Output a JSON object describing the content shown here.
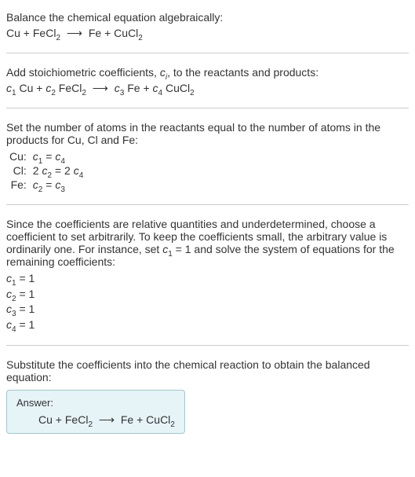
{
  "section1": {
    "heading": "Balance the chemical equation algebraically:"
  },
  "chem": {
    "Cu": "Cu",
    "plus": " + ",
    "FeCl": "FeCl",
    "two": "2",
    "arrow": "⟶",
    "Fe": "Fe",
    "CuCl": "CuCl"
  },
  "section2": {
    "heading_a": "Add stoichiometric coefficients, ",
    "heading_b": ", to the reactants and products:",
    "c": "c",
    "i": "i",
    "one": "1",
    "two": "2",
    "three": "3",
    "four": "4",
    "sp": " "
  },
  "section3": {
    "heading": "Set the number of atoms in the reactants equal to the number of atoms in the products for Cu, Cl and Fe:",
    "rows": [
      {
        "el": "Cu:",
        "lhs_a": "c",
        "lhs_b": "1",
        "eq": " = ",
        "rhs_a": "c",
        "rhs_b": "4"
      },
      {
        "el": "Cl:",
        "lhs_pre": "2 ",
        "lhs_a": "c",
        "lhs_b": "2",
        "eq": " = 2 ",
        "rhs_a": "c",
        "rhs_b": "4"
      },
      {
        "el": "Fe:",
        "lhs_a": "c",
        "lhs_b": "2",
        "eq": " = ",
        "rhs_a": "c",
        "rhs_b": "3"
      }
    ]
  },
  "section4": {
    "heading_a": "Since the coefficients are relative quantities and underdetermined, choose a coefficient to set arbitrarily. To keep the coefficients small, the arbitrary value is ordinarily one. For instance, set ",
    "heading_b": " = 1 and solve the system of equations for the remaining coefficients:",
    "c": "c",
    "one": "1",
    "coefs": [
      {
        "c": "c",
        "s": "1",
        "v": " = 1"
      },
      {
        "c": "c",
        "s": "2",
        "v": " = 1"
      },
      {
        "c": "c",
        "s": "3",
        "v": " = 1"
      },
      {
        "c": "c",
        "s": "4",
        "v": " = 1"
      }
    ]
  },
  "section5": {
    "heading": "Substitute the coefficients into the chemical reaction to obtain the balanced equation:",
    "answer_label": "Answer:"
  }
}
